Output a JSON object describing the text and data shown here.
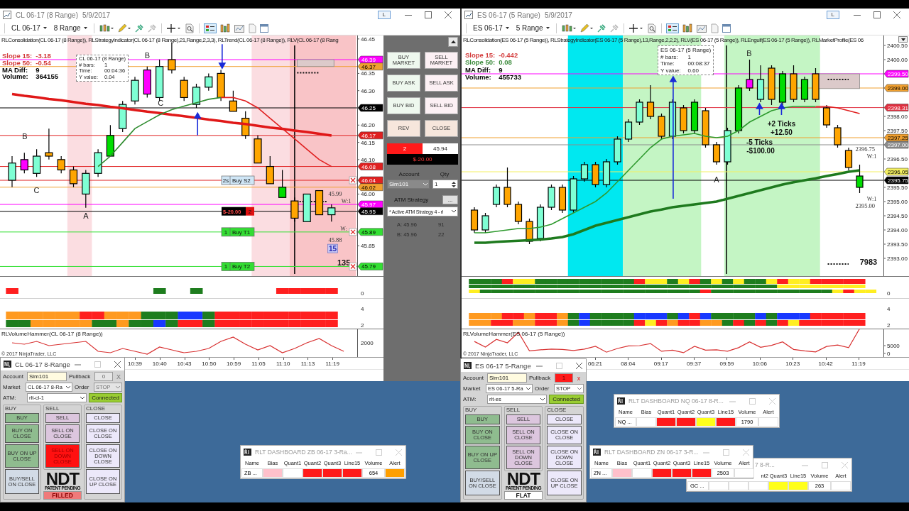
{
  "windows": [
    {
      "title": "CL 06-17 (8 Range)",
      "date": "5/9/2017",
      "title_button": "L",
      "toolbar": {
        "instrument": "CL 06-17",
        "interval": "8 Range"
      },
      "price_pane": {
        "indicator_label": "RLConsolidation(CL 06-17 (8 Range)), RLStrategyIndicator(CL 06-17 (8 Range),21,Range,2,3,3), RLTrend(CL 06-17 (8 Range)), RLV(CL 06-17 (8 Rang",
        "stats": [
          {
            "label": "Slope 15:",
            "value": "-3.18",
            "color": "#d33a3a"
          },
          {
            "label": "Slope 50:",
            "value": "-0.54",
            "color": "#d33a3a"
          },
          {
            "label": "MA Diff:",
            "value": "9",
            "color": "#000000"
          },
          {
            "label": "Volume:",
            "value": "364155",
            "color": "#000000"
          }
        ],
        "tooltip": {
          "title": "CL 06-17 (8 Range)",
          "rows": [
            {
              "label": "# bars:",
              "value": "1"
            },
            {
              "label": "Time:",
              "value": "00:04:36"
            },
            {
              "label": "Y value:",
              "value": "0.04"
            }
          ]
        },
        "order_tags": [
          {
            "qty": "2s",
            "name": "Buy S2",
            "kind": "stop"
          },
          {
            "qty": "1",
            "name": "Buy T1",
            "kind": "target"
          },
          {
            "qty": "1",
            "name": "Buy T2",
            "kind": "target"
          }
        ],
        "position_tag": {
          "pnl": "$-20.00",
          "qty": "2"
        },
        "chart_data": {
          "type": "candlestick",
          "tick_labels": "y",
          "ylim": [
            45.76,
            46.46
          ],
          "yticks": [
            {
              "value": 45.85,
              "label": "45.85"
            },
            {
              "value": 46.0,
              "label": "46.00"
            },
            {
              "value": 46.1,
              "label": "46.10"
            },
            {
              "value": 46.15,
              "label": "46.15"
            },
            {
              "value": 46.2,
              "label": "46.20"
            },
            {
              "value": 46.3,
              "label": "46.30"
            },
            {
              "value": 46.35,
              "label": "46.35"
            },
            {
              "value": 46.45,
              "label": "46.45"
            }
          ],
          "ohlc": [
            [
              46.04,
              46.11,
              46.02,
              46.09
            ],
            [
              46.07,
              46.12,
              46.06,
              46.1
            ],
            [
              46.06,
              46.13,
              46.05,
              46.11
            ],
            [
              46.12,
              46.19,
              46.1,
              46.11
            ],
            [
              46.1,
              46.11,
              46.06,
              46.07
            ],
            [
              46.07,
              46.08,
              46.02,
              46.03
            ],
            [
              46.0,
              46.07,
              45.96,
              46.06
            ],
            [
              46.06,
              46.13,
              46.05,
              46.12
            ],
            [
              46.11,
              46.2,
              46.11,
              46.17
            ],
            [
              46.19,
              46.27,
              46.18,
              46.26
            ],
            [
              46.27,
              46.34,
              46.26,
              46.33
            ],
            [
              46.29,
              46.37,
              46.28,
              46.36
            ],
            [
              46.28,
              46.39,
              46.27,
              46.37
            ],
            [
              46.39,
              46.44,
              46.35,
              46.36
            ],
            [
              46.33,
              46.34,
              46.27,
              46.28
            ],
            [
              46.26,
              46.32,
              46.25,
              46.31
            ],
            [
              46.31,
              46.35,
              46.3,
              46.34
            ],
            [
              46.35,
              46.36,
              46.27,
              46.28
            ],
            [
              46.27,
              46.3,
              46.24,
              46.24
            ],
            [
              46.22,
              46.24,
              46.16,
              46.17
            ],
            [
              46.16,
              46.17,
              46.09,
              46.09
            ],
            [
              46.08,
              46.11,
              46.03,
              46.03
            ],
            [
              45.99,
              46.07,
              45.99,
              46.02
            ],
            [
              45.98,
              45.99,
              45.92,
              45.93
            ],
            [
              45.92,
              46.0,
              45.92,
              46.0
            ],
            [
              46.01,
              46.01,
              45.94,
              45.94
            ],
            [
              45.94,
              45.97,
              45.92,
              45.96
            ]
          ],
          "colors": [
            "#7fffd4",
            "#ff00ff",
            "#7fffd4",
            "#ffa500",
            "#ffa500",
            "#ffa500",
            "#7fffd4",
            "#7fffd4",
            "#00dd00",
            "#7fffd4",
            "#7fffd4",
            "#ff00ff",
            "#7fffd4",
            "#ffa500",
            "#ffa500",
            "#7fffd4",
            "#7fffd4",
            "#ffa500",
            "#ffa500",
            "#ffa500",
            "#ffa500",
            "#ffa500",
            "#00dd00",
            "#ffa500",
            "#7fffd4",
            "#ffa500",
            "#7fffd4"
          ],
          "series": [
            {
              "type": "line",
              "color": "#e01818",
              "values": [
                46.29,
                46.285,
                46.281,
                46.276,
                46.272,
                46.267,
                46.262,
                46.258,
                46.253,
                46.249,
                46.244,
                46.239,
                46.235,
                46.23,
                46.226,
                46.221,
                46.216,
                46.212,
                46.207,
                46.203,
                46.198,
                46.193,
                46.189,
                46.184,
                46.18,
                46.175,
                46.17
              ]
            },
            {
              "type": "line",
              "color": "#2e8b2e",
              "values": [
                null,
                null,
                null,
                null,
                null,
                null,
                null,
                46.08,
                46.11,
                46.15,
                46.19,
                46.21,
                46.23,
                46.245,
                46.255,
                46.265,
                46.275,
                46.28,
                null,
                null,
                null,
                null,
                null,
                null,
                null,
                null,
                null
              ]
            },
            {
              "type": "line",
              "color": "#e02020",
              "values": [
                null,
                null,
                null,
                null,
                null,
                null,
                null,
                null,
                null,
                null,
                null,
                null,
                null,
                null,
                null,
                null,
                null,
                46.28,
                46.28,
                46.27,
                46.25,
                46.22,
                46.19,
                46.16,
                46.13,
                46.1,
                46.08
              ]
            }
          ],
          "ref_lines": [
            {
              "axis": "y",
              "value": 46.39,
              "label": "46.39",
              "color": "#ff00ff"
            },
            {
              "axis": "y",
              "value": 46.37,
              "label": "46.37",
              "color": "#f0a030"
            },
            {
              "axis": "y",
              "value": 46.25,
              "label": "46.25",
              "color": "#000000"
            },
            {
              "axis": "y",
              "value": 46.17,
              "label": "46.17",
              "color": "#e02020"
            },
            {
              "axis": "y",
              "value": 46.08,
              "label": "46.08",
              "color": "#e02020"
            },
            {
              "axis": "y",
              "value": 46.04,
              "label": "46.04",
              "color": "#e02020"
            },
            {
              "axis": "y",
              "value": 46.02,
              "label": "46.02",
              "color": "#f0a030"
            },
            {
              "axis": "y",
              "value": 45.97,
              "label": "45.97",
              "color": "#ff00ff"
            },
            {
              "axis": "y",
              "value": 45.95,
              "label": "45.95",
              "color": "#000000"
            },
            {
              "axis": "y",
              "value": 45.89,
              "label": "45.89",
              "color": "#33e033"
            },
            {
              "axis": "y",
              "value": 45.79,
              "label": "45.79",
              "color": "#33e033"
            }
          ],
          "annotations": [
            "B",
            "C",
            "A",
            "B",
            "C",
            "45.99",
            "W:1",
            "W:",
            "45.88",
            "15",
            "135"
          ]
        }
      },
      "signal_panes": [
        {
          "axis_labels": [
            "0"
          ]
        },
        {
          "axis_labels": [
            "4",
            "2"
          ]
        }
      ],
      "volume_pane": {
        "label": "RLVolumeHammer(CL 06-17 (8 Range))",
        "axis_labels": [
          "2000"
        ]
      },
      "copyright": "© 2017 NinjaTrader, LLC",
      "time_axis": [
        "10:39",
        "10:40",
        "10:43",
        "10:50",
        "10:59",
        "11:05",
        "11:10",
        "11:13",
        "11:19"
      ],
      "order_panel": {
        "buttons": [
          {
            "label": "BUY MARKET",
            "kind": "buy"
          },
          {
            "label": "SELL MARKET",
            "kind": "sell"
          },
          {
            "label": "BUY ASK",
            "kind": "buy"
          },
          {
            "label": "SELL ASK",
            "kind": "sell"
          },
          {
            "label": "BUY BID",
            "kind": "buy"
          },
          {
            "label": "SELL BID",
            "kind": "sell"
          },
          {
            "label": "REV",
            "kind": "action"
          },
          {
            "label": "CLOSE",
            "kind": "action"
          }
        ],
        "position": {
          "qty": "2",
          "price": "45.94",
          "pnl": "$-20.00"
        },
        "account": {
          "label": "Account",
          "value": "Sim101",
          "disabled": true
        },
        "quantity": {
          "label": "Qty",
          "value": "1"
        },
        "atm": {
          "label": "ATM Strategy",
          "button": "...",
          "value": "* Active ATM Strategy 4 - rl"
        },
        "quotes": [
          {
            "label": "A: 45.96",
            "size": "91"
          },
          {
            "label": "B: 45.96",
            "size": "22"
          }
        ]
      }
    },
    {
      "title": "ES 06-17 (5 Range)",
      "date": "5/9/2017",
      "title_button": "L",
      "toolbar": {
        "instrument": "ES 06-17",
        "interval": "5 Range"
      },
      "price_pane": {
        "indicator_label": "RLConsolidation(ES 06-17 (5 Range)), RLStrategyIndicator(ES 06-17 (5 Range),13,Range,2,2,2), RLV(ES 06-17 (5 Range)), RLEngulf(ES 06-17 (5 Range)), RLMarketProfile(ES 06",
        "stats": [
          {
            "label": "Slope 15:",
            "value": "-0.442",
            "color": "#d33a3a"
          },
          {
            "label": "Slope 50:",
            "value": "0.08",
            "color": "#3a8a3a"
          },
          {
            "label": "MA Diff:",
            "value": "9",
            "color": "#000000"
          },
          {
            "label": "Volume:",
            "value": "455733",
            "color": "#000000"
          }
        ],
        "tooltip": {
          "title": "ES 06-17 (5 Range)",
          "rows": [
            {
              "label": "# bars:",
              "value": "1"
            },
            {
              "label": "Time:",
              "value": "00:08:37"
            },
            {
              "label": "Y value:",
              "value": "0.60"
            }
          ]
        },
        "chart_data": {
          "type": "candlestick",
          "tick_labels": "y",
          "ylim": [
            2392.35,
            2400.85
          ],
          "yticks": [
            {
              "value": 2393.0,
              "label": "2393.00"
            },
            {
              "value": 2393.5,
              "label": "2393.50"
            },
            {
              "value": 2394.0,
              "label": "2394.00"
            },
            {
              "value": 2394.5,
              "label": "2394.50"
            },
            {
              "value": 2395.0,
              "label": "2395.00"
            },
            {
              "value": 2395.5,
              "label": "2395.50"
            },
            {
              "value": 2396.5,
              "label": "2396.50"
            },
            {
              "value": 2397.5,
              "label": "2397.50"
            },
            {
              "value": 2398.0,
              "label": "2398.00"
            },
            {
              "value": 2400.0,
              "label": "2400.00"
            },
            {
              "value": 2400.5,
              "label": "2400.50"
            }
          ],
          "ohlc": [
            [
              2394.7,
              2394.8,
              2393.9,
              2394.0
            ],
            [
              2394.0,
              2394.6,
              2393.9,
              2394.5
            ],
            [
              2394.9,
              2395.6,
              2394.8,
              2395.5
            ],
            [
              2395.5,
              2396.2,
              2394.8,
              2394.9
            ],
            [
              2394.9,
              2395.0,
              2394.2,
              2394.3
            ],
            [
              2394.3,
              2394.4,
              2393.5,
              2393.6
            ],
            [
              2393.7,
              2394.9,
              2393.6,
              2394.8
            ],
            [
              2394.8,
              2395.6,
              2394.7,
              2395.5
            ],
            [
              2395.5,
              2395.6,
              2394.6,
              2394.7
            ],
            [
              2394.7,
              2395.9,
              2394.6,
              2395.8
            ],
            [
              2395.8,
              2396.4,
              2395.7,
              2396.3
            ],
            [
              2396.3,
              2396.4,
              2395.5,
              2395.6
            ],
            [
              2395.6,
              2396.5,
              2395.5,
              2396.4
            ],
            [
              2396.4,
              2397.3,
              2396.3,
              2397.2
            ],
            [
              2397.2,
              2397.9,
              2397.1,
              2397.8
            ],
            [
              2397.8,
              2398.6,
              2397.7,
              2398.5
            ],
            [
              2398.5,
              2399.1,
              2397.9,
              2398.0
            ],
            [
              2398.0,
              2398.1,
              2397.2,
              2397.3
            ],
            [
              2397.3,
              2398.6,
              2397.2,
              2398.5
            ],
            [
              2398.3,
              2398.4,
              2397.4,
              2397.5
            ],
            [
              2397.5,
              2398.6,
              2397.4,
              2398.5
            ],
            [
              2398.2,
              2398.3,
              2396.9,
              2397.0
            ],
            [
              2397.0,
              2397.1,
              2396.3,
              2396.4
            ],
            [
              2396.4,
              2397.6,
              2396.3,
              2397.5
            ],
            [
              2397.5,
              2399.1,
              2397.4,
              2399.0
            ],
            [
              2399.0,
              2400.0,
              2398.9,
              2399.3
            ],
            [
              2398.6,
              2399.8,
              2398.5,
              2399.3
            ],
            [
              2399.7,
              2399.8,
              2398.4,
              2398.6
            ],
            [
              2398.5,
              2399.6,
              2398.4,
              2399.5
            ],
            [
              2399.5,
              2399.8,
              2398.5,
              2398.6
            ],
            [
              2398.6,
              2399.4,
              2398.5,
              2399.3
            ],
            [
              2399.5,
              2399.7,
              2398.5,
              2398.6
            ],
            [
              2398.3,
              2398.4,
              2397.6,
              2397.7
            ],
            [
              2397.6,
              2397.7,
              2396.9,
              2397.0
            ],
            [
              2396.8,
              2396.9,
              2396.1,
              2396.2
            ],
            [
              2395.5,
              2396.3,
              2395.3,
              2395.9
            ]
          ],
          "colors": [
            "#ffa500",
            "#7fffd4",
            "#7fffd4",
            "#ffa500",
            "#ffa500",
            "#ffa500",
            "#7fffd4",
            "#7fffd4",
            "#ffa500",
            "#7fffd4",
            "#7fffd4",
            "#ffa500",
            "#7fffd4",
            "#7fffd4",
            "#7fffd4",
            "#7fffd4",
            "#ffa500",
            "#ffa500",
            "#7fffd4",
            "#ffa500",
            "#00dd00",
            "#ffa500",
            "#ffa500",
            "#7fffd4",
            "#00dd00",
            "#ff00ff",
            "#7fffd4",
            "#ffa500",
            "#00dd00",
            "#ffa500",
            "#00dd00",
            "#ffa500",
            "#ffa500",
            "#ffa500",
            "#ffa500",
            "#00dd00"
          ],
          "series": [
            {
              "type": "line",
              "color": "#1e7a1e",
              "values": [
                2393.55,
                2393.55,
                2393.58,
                2393.6,
                2393.62,
                2393.64,
                2393.66,
                2393.7,
                2393.75,
                2393.85,
                2394.0,
                2394.15,
                2394.25,
                2394.35,
                2394.45,
                2394.55,
                2394.65,
                2394.72,
                2394.8,
                2394.85,
                2394.9,
                2394.95,
                2395.0,
                2395.1,
                2395.2,
                2395.3,
                2395.4,
                2395.5,
                2395.6,
                2395.68,
                2395.75,
                2395.82,
                2395.9,
                2395.97,
                2396.05,
                2396.1
              ]
            },
            {
              "type": "line",
              "color": "#2e9a2e",
              "values": [
                2393.9,
                2393.9,
                2393.95,
                2394.0,
                2394.05,
                2394.05,
                2394.1,
                2394.2,
                2394.4,
                2394.6,
                2394.8,
                2395.0,
                2395.3,
                2395.7,
                2396.1,
                2396.5,
                2396.9,
                2397.2,
                2397.3,
                2397.35,
                2397.4,
                2397.3,
                2397.25,
                2397.3,
                2397.5,
                2397.8,
                2398.0,
                2398.2,
                2398.3,
                2398.35,
                2398.35,
                2398.35,
                null,
                null,
                null,
                null
              ]
            },
            {
              "type": "line",
              "color": "#e02020",
              "values": [
                null,
                null,
                null,
                null,
                null,
                null,
                null,
                null,
                null,
                null,
                null,
                null,
                null,
                null,
                null,
                null,
                null,
                null,
                null,
                null,
                null,
                null,
                null,
                null,
                null,
                null,
                null,
                null,
                null,
                null,
                null,
                2398.35,
                2398.35,
                2398.3,
                2398.2,
                2398.1
              ]
            }
          ],
          "ref_lines": [
            {
              "axis": "y",
              "value": 2399.5,
              "label": "2399.50",
              "color": "#ff00ff"
            },
            {
              "axis": "y",
              "value": 2399.0,
              "label": "2399.00",
              "color": "#f0a030"
            },
            {
              "axis": "y",
              "value": 2398.31,
              "label": "2398.31",
              "color": "#e03040"
            },
            {
              "axis": "y",
              "value": 2397.25,
              "label": "2397.25",
              "color": "#f0a030"
            },
            {
              "axis": "y",
              "value": 2397.0,
              "label": "2397.00",
              "color": "#8c8c8c"
            },
            {
              "axis": "y",
              "value": 2396.05,
              "label": "2396.05",
              "color": "#f4f060"
            },
            {
              "axis": "y",
              "value": 2395.75,
              "label": "2395.75",
              "color": "#000000"
            }
          ],
          "annotations": [
            "B",
            "A",
            "+2 Ticks",
            "+12.50",
            "-5 Ticks",
            "-$100.00",
            "2396.75",
            "W:1",
            "W:1",
            "2395.00",
            "7983"
          ]
        }
      },
      "signal_panes": [
        {
          "axis_labels": [
            "0"
          ]
        },
        {
          "axis_labels": [
            "4",
            "2"
          ]
        }
      ],
      "volume_pane": {
        "label": "RLVolumeHammer(ES 06-17 (5 Range))",
        "chart_data": {
          "type": "line",
          "tick_labels": "y",
          "ylim": [
            -2270,
            15910
          ],
          "yticks": [
            0,
            5000
          ],
          "series": [
            {
              "color": "#d83030",
              "values": [
                7700,
                4100,
                9000,
                6800,
                13500,
                1700,
                2300,
                2800,
                2600,
                1900,
                2800,
                4600,
                800,
                3200,
                4800,
                5000,
                6300,
                1400,
                2100,
                500,
                4600,
                2100,
                2300,
                1400,
                3700,
                7400,
                3900,
                5200,
                7400,
                2600,
                1700,
                1000,
                4500,
                5400,
                3700,
                15900
              ]
            }
          ]
        }
      },
      "copyright": "© 2017 NinjaTrader, LLC",
      "time_axis": [
        "06:21",
        "08:04",
        "09:17",
        "09:37",
        "09:59",
        "10:06",
        "10:23",
        "10:42",
        "11:19"
      ]
    }
  ],
  "ndt_panels": [
    {
      "title": "CL 06-17 8-Range",
      "account": {
        "label": "Account",
        "value": "Sim101"
      },
      "pullback": {
        "label": "Pullback",
        "value": "0",
        "alert": false
      },
      "clear_button": {
        "label": "X",
        "alert": false
      },
      "market": {
        "label": "Market",
        "value": "CL 06-17 8-Ra"
      },
      "order": {
        "label": "Order",
        "value": "STOP",
        "disabled": true
      },
      "atm": {
        "label": "ATM:",
        "value": "rlt-cl-1"
      },
      "connection": {
        "label": "Connected",
        "connected": true
      },
      "groups": [
        {
          "title": "BUY",
          "buttons": [
            {
              "label": "BUY",
              "kind": "buy",
              "active": false
            },
            {
              "label": "BUY ON CLOSE",
              "kind": "buy",
              "active": false
            },
            {
              "label": "BUY ON UP CLOSE",
              "kind": "buy",
              "active": false
            },
            {
              "label": "BUY/SELL ON CLOSE",
              "kind": "both",
              "active": false
            }
          ]
        },
        {
          "title": "SELL",
          "buttons": [
            {
              "label": "SELL",
              "kind": "sell",
              "active": false
            },
            {
              "label": "SELL ON CLOSE",
              "kind": "sell",
              "active": false
            },
            {
              "label": "SELL ON DOWN CLOSE",
              "kind": "sell",
              "active": true
            }
          ]
        },
        {
          "title": "CLOSE",
          "buttons": [
            {
              "label": "CLOSE",
              "kind": "close",
              "active": false
            },
            {
              "label": "CLOSE ON CLOSE",
              "kind": "close",
              "active": false
            },
            {
              "label": "CLOSE ON DOWN CLOSE",
              "kind": "close",
              "active": false
            },
            {
              "label": "CLOSE ON UP CLOSE",
              "kind": "close",
              "active": false
            }
          ]
        }
      ],
      "logo": {
        "title": "NDT",
        "subtitle": "PATENT PENDING"
      },
      "state": {
        "label": "FILLED",
        "filled": true
      }
    },
    {
      "title": "ES 06-17 5-Range",
      "account": {
        "label": "Account",
        "value": "Sim101"
      },
      "pullback": {
        "label": "Pullback",
        "value": "1",
        "alert": true
      },
      "clear_button": {
        "label": "x",
        "alert": true
      },
      "market": {
        "label": "Market",
        "value": "ES 06-17 5-Ra"
      },
      "order": {
        "label": "Order",
        "value": "STOP",
        "disabled": false
      },
      "atm": {
        "label": "ATM:",
        "value": "rlt-es"
      },
      "connection": {
        "label": "Connected",
        "connected": true
      },
      "groups": [
        {
          "title": "BUY",
          "buttons": [
            {
              "label": "BUY",
              "kind": "buy",
              "active": false
            },
            {
              "label": "BUY ON CLOSE",
              "kind": "buy",
              "active": false
            },
            {
              "label": "BUY ON UP CLOSE",
              "kind": "buy",
              "active": false
            },
            {
              "label": "BUY/SELL ON CLOSE",
              "kind": "both",
              "active": false
            }
          ]
        },
        {
          "title": "SELL",
          "buttons": [
            {
              "label": "SELL",
              "kind": "sell",
              "active": false
            },
            {
              "label": "SELL ON CLOSE",
              "kind": "sell",
              "active": false
            },
            {
              "label": "SELL ON DOWN CLOSE",
              "kind": "sell",
              "active": false
            }
          ]
        },
        {
          "title": "CLOSE",
          "buttons": [
            {
              "label": "CLOSE",
              "kind": "close",
              "active": false
            },
            {
              "label": "CLOSE ON CLOSE",
              "kind": "close",
              "active": false
            },
            {
              "label": "CLOSE ON DOWN CLOSE",
              "kind": "close",
              "active": false
            },
            {
              "label": "CLOSE ON UP CLOSE",
              "kind": "close",
              "active": false
            }
          ]
        }
      ],
      "logo": {
        "title": "NDT",
        "subtitle": "PATENT PENDING"
      },
      "state": {
        "label": "FLAT",
        "filled": false
      }
    }
  ],
  "dashboards": [
    {
      "title": "RLT DASHBOARD NQ 06-17 8-R...",
      "columns": [
        "Name",
        "Bias",
        "Quant1",
        "Quant2",
        "Quant3",
        "Line15",
        "Volume",
        "Alert"
      ],
      "row": {
        "name": "NQ ...",
        "signals": [
          {
            "color": "#ffffff"
          },
          {
            "color": "#ff1a1a"
          },
          {
            "color": "#ff1a1a"
          },
          {
            "color": "#ffff1a"
          },
          {
            "color": "#ff1a1a"
          }
        ],
        "volume": "1790",
        "alert": {
          "color": "#ffffff"
        }
      }
    },
    {
      "title": "RLT DASHBOARD ZB 06-17 3-Ra...",
      "columns": [
        "Name",
        "Bias",
        "Quant1",
        "Quant2",
        "Quant3",
        "Line15",
        "Volume",
        "Alert"
      ],
      "row": {
        "name": "ZB ...",
        "signals": [
          {
            "color": "#ffc0cb"
          },
          {
            "color": "#ffffff"
          },
          {
            "color": "#ff1a1a"
          },
          {
            "color": "#ff1a1a"
          },
          {
            "color": "#ff1a1a"
          }
        ],
        "volume": "654",
        "alert": {
          "color": "#ff9f00"
        }
      }
    },
    {
      "title": "RLT DASHBOARD ZN 06-17 3-R...",
      "columns": [
        "Name",
        "Bias",
        "Quant1",
        "Quant2",
        "Quant3",
        "Line15",
        "Volume",
        "Alert"
      ],
      "row": {
        "name": "ZN ...",
        "signals": [
          {
            "color": "#ffc0cb"
          },
          {
            "color": "#ffffff"
          },
          {
            "color": "#ff1a1a"
          },
          {
            "color": "#ff1a1a"
          },
          {
            "color": "#ff1a1a"
          }
        ],
        "volume": "2503",
        "alert": {
          "color": "#ffffff"
        }
      }
    },
    {
      "title": "7 8-R...",
      "columns": [
        "nt2",
        "Quant3",
        "Line15",
        "Volume",
        "Alert"
      ],
      "row": {
        "name": "GC ...",
        "signals": [
          {
            "color": "#ffffff"
          },
          {
            "color": "#ffffff"
          },
          {
            "color": "#ffffff"
          },
          {
            "color": "#ffff1a"
          },
          {
            "color": "#ffff1a"
          }
        ],
        "volume": "263",
        "alert": {
          "color": "#ffffff"
        }
      }
    }
  ]
}
